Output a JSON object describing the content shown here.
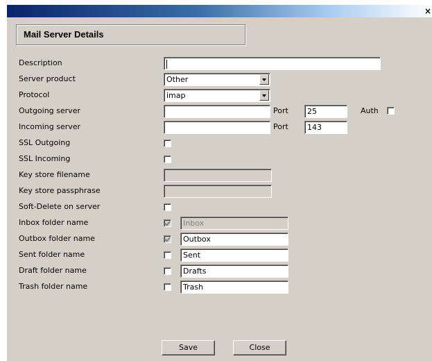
{
  "window": {
    "close_glyph": "×"
  },
  "header": {
    "title": "Mail Server Details"
  },
  "labels": {
    "description": "Description",
    "server_product": "Server product",
    "protocol": "Protocol",
    "outgoing_server": "Outgoing server",
    "incoming_server": "Incoming server",
    "ssl_outgoing": "SSL Outgoing",
    "ssl_incoming": "SSL Incoming",
    "key_store_filename": "Key store filename",
    "key_store_passphrase": "Key store passphrase",
    "soft_delete": "Soft-Delete on server",
    "inbox_folder": "Inbox folder name",
    "outbox_folder": "Outbox folder name",
    "sent_folder": "Sent folder name",
    "draft_folder": "Draft folder name",
    "trash_folder": "Trash folder name",
    "port": "Port",
    "auth": "Auth"
  },
  "values": {
    "description": "",
    "server_product": "Other",
    "protocol": "imap",
    "outgoing_server": "",
    "outgoing_port": "25",
    "incoming_server": "",
    "incoming_port": "143",
    "key_store_filename": "",
    "key_store_passphrase": "",
    "inbox_folder": "Inbox",
    "outbox_folder": "Outbox",
    "sent_folder": "Sent",
    "draft_folder": "Drafts",
    "trash_folder": "Trash"
  },
  "checkboxes": {
    "auth": false,
    "ssl_outgoing": false,
    "ssl_incoming": false,
    "soft_delete": false,
    "inbox": true,
    "outbox": true,
    "sent": false,
    "draft": false,
    "trash": false
  },
  "buttons": {
    "save": "Save",
    "close": "Close"
  }
}
